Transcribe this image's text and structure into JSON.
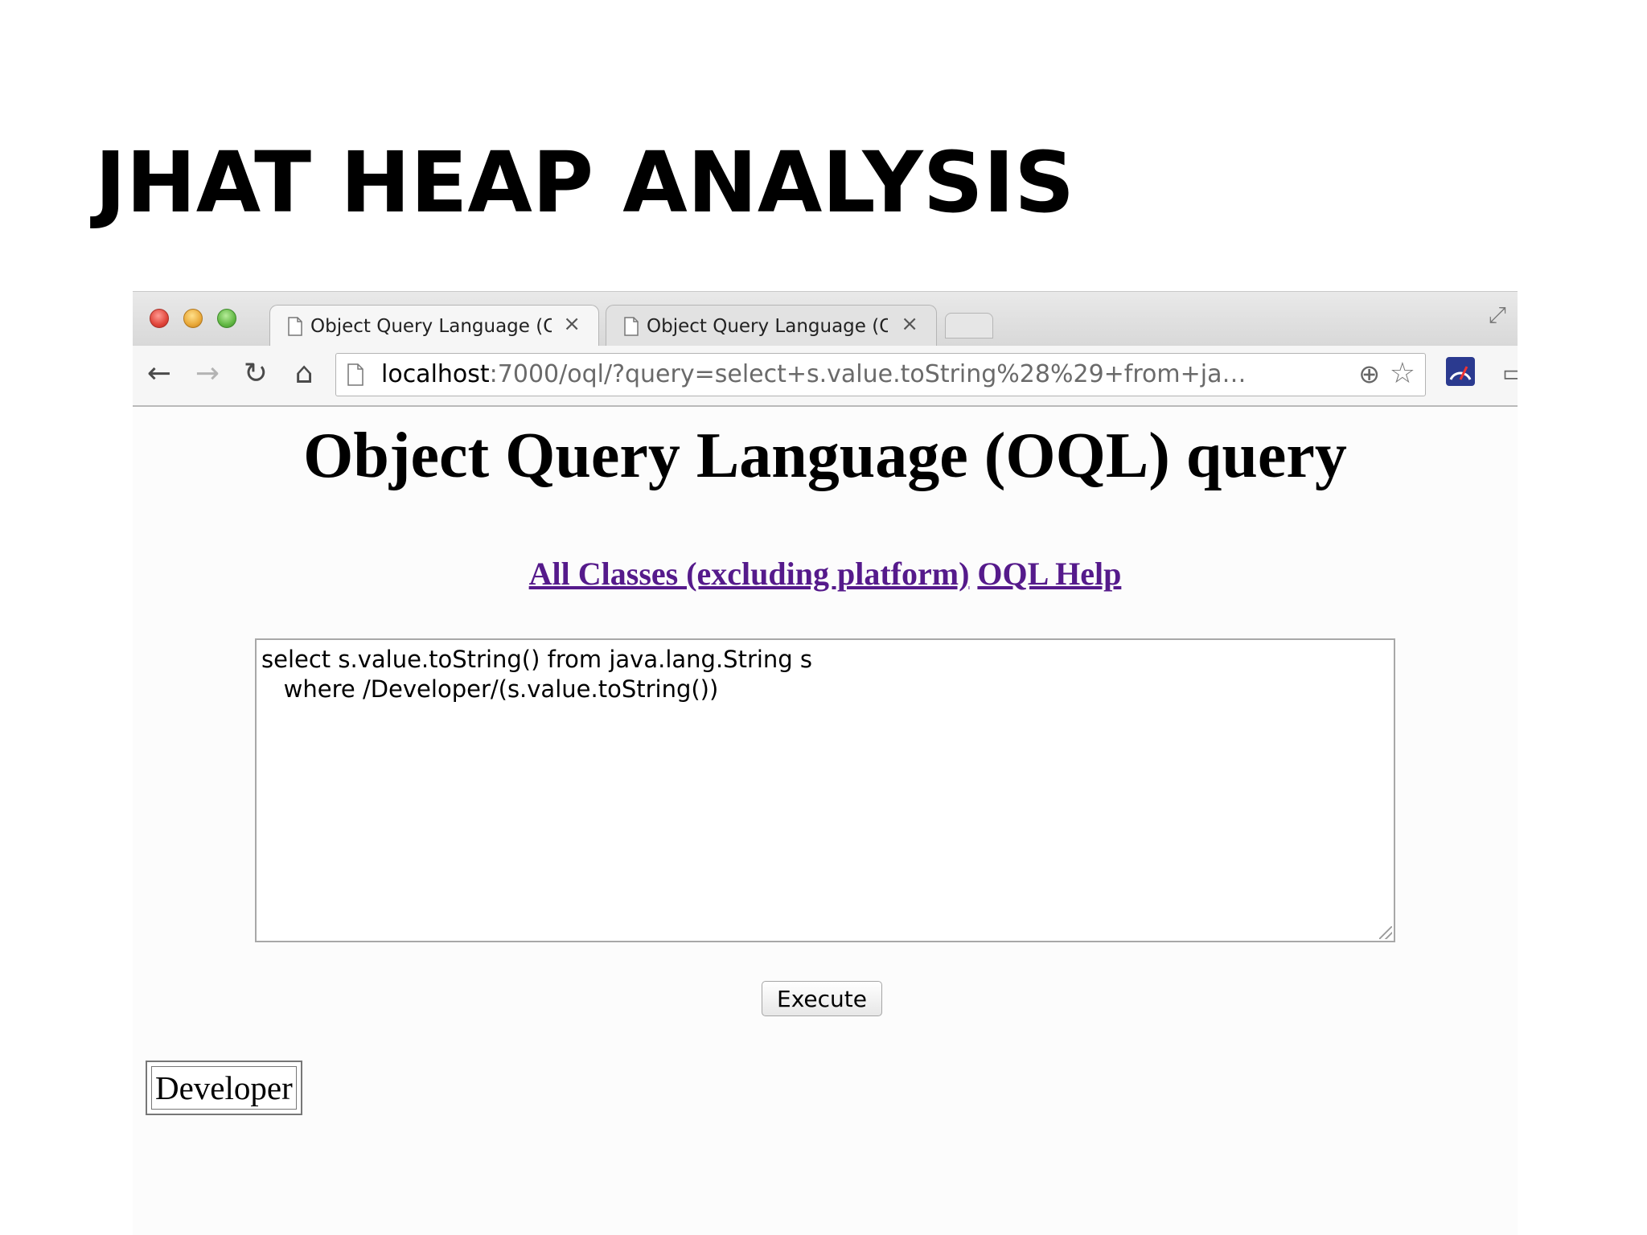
{
  "slide": {
    "title": "JHAT HEAP ANALYSIS"
  },
  "browser": {
    "tabs": [
      {
        "label": "Object Query Language (O",
        "close": "×",
        "active": true
      },
      {
        "label": "Object Query Language (O",
        "close": "×",
        "active": false
      }
    ],
    "nav": {
      "back": "←",
      "forward": "→",
      "reload": "↻",
      "home": "⌂"
    },
    "address": {
      "host": "localhost",
      "rest": ":7000/oql/?query=select+s.value.toString%28%29+from+ja…"
    },
    "icons": {
      "zoom": "⊕",
      "star": "☆",
      "cast": "▭",
      "incognito": "◓◓",
      "menu": "≡",
      "fullscreen": "⤢"
    }
  },
  "page": {
    "heading": "Object Query Language (OQL) query",
    "links": [
      {
        "label": "All Classes (excluding platform)"
      },
      {
        "label": "OQL Help"
      }
    ],
    "query_text": "select s.value.toString() from java.lang.String s\n   where /Developer/(s.value.toString())",
    "execute_label": "Execute",
    "results": [
      "Developer"
    ]
  }
}
